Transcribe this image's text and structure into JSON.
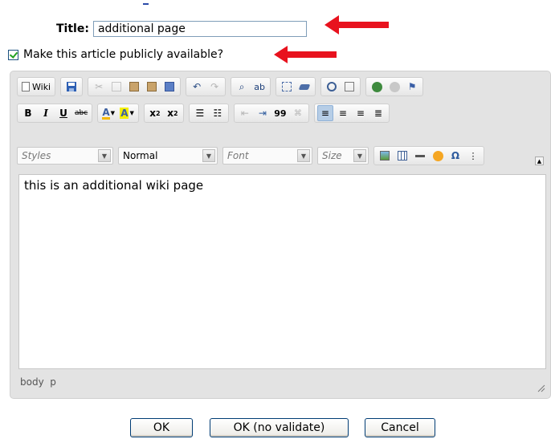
{
  "form": {
    "title_label": "Title:",
    "title_value": "additional page",
    "public_label": "Make this article publicly available?",
    "public_checked": true
  },
  "toolbar": {
    "row1": {
      "wiki_label": "Wiki",
      "icons": [
        "wiki-source-icon",
        "save-icon",
        "cut-icon",
        "copy-icon",
        "paste-icon",
        "paste-text-icon",
        "paste-word-icon",
        "undo-icon",
        "redo-icon",
        "find-icon",
        "replace-icon",
        "select-all-icon",
        "remove-format-icon",
        "maximize-icon",
        "show-blocks-icon",
        "link-icon",
        "unlink-icon",
        "anchor-icon"
      ]
    },
    "row2": {
      "bold": "B",
      "italic": "I",
      "underline": "U",
      "strike": "abc",
      "text_color": "A",
      "bg_color": "A",
      "subscript_base": "x",
      "subscript_mark": "2",
      "superscript_base": "x",
      "superscript_mark": "2",
      "blockquote": "99"
    },
    "row3": {
      "styles_placeholder": "Styles",
      "format_value": "Normal",
      "font_placeholder": "Font",
      "size_placeholder": "Size",
      "special_char": "Ω"
    }
  },
  "editor": {
    "content": "this is an additional wiki page",
    "element_path": "body  p"
  },
  "buttons": {
    "ok": "OK",
    "ok_no_validate": "OK (no validate)",
    "cancel": "Cancel"
  },
  "colors": {
    "arrow": "#e8121e",
    "accent": "#b6cde6",
    "check": "#21a121"
  }
}
